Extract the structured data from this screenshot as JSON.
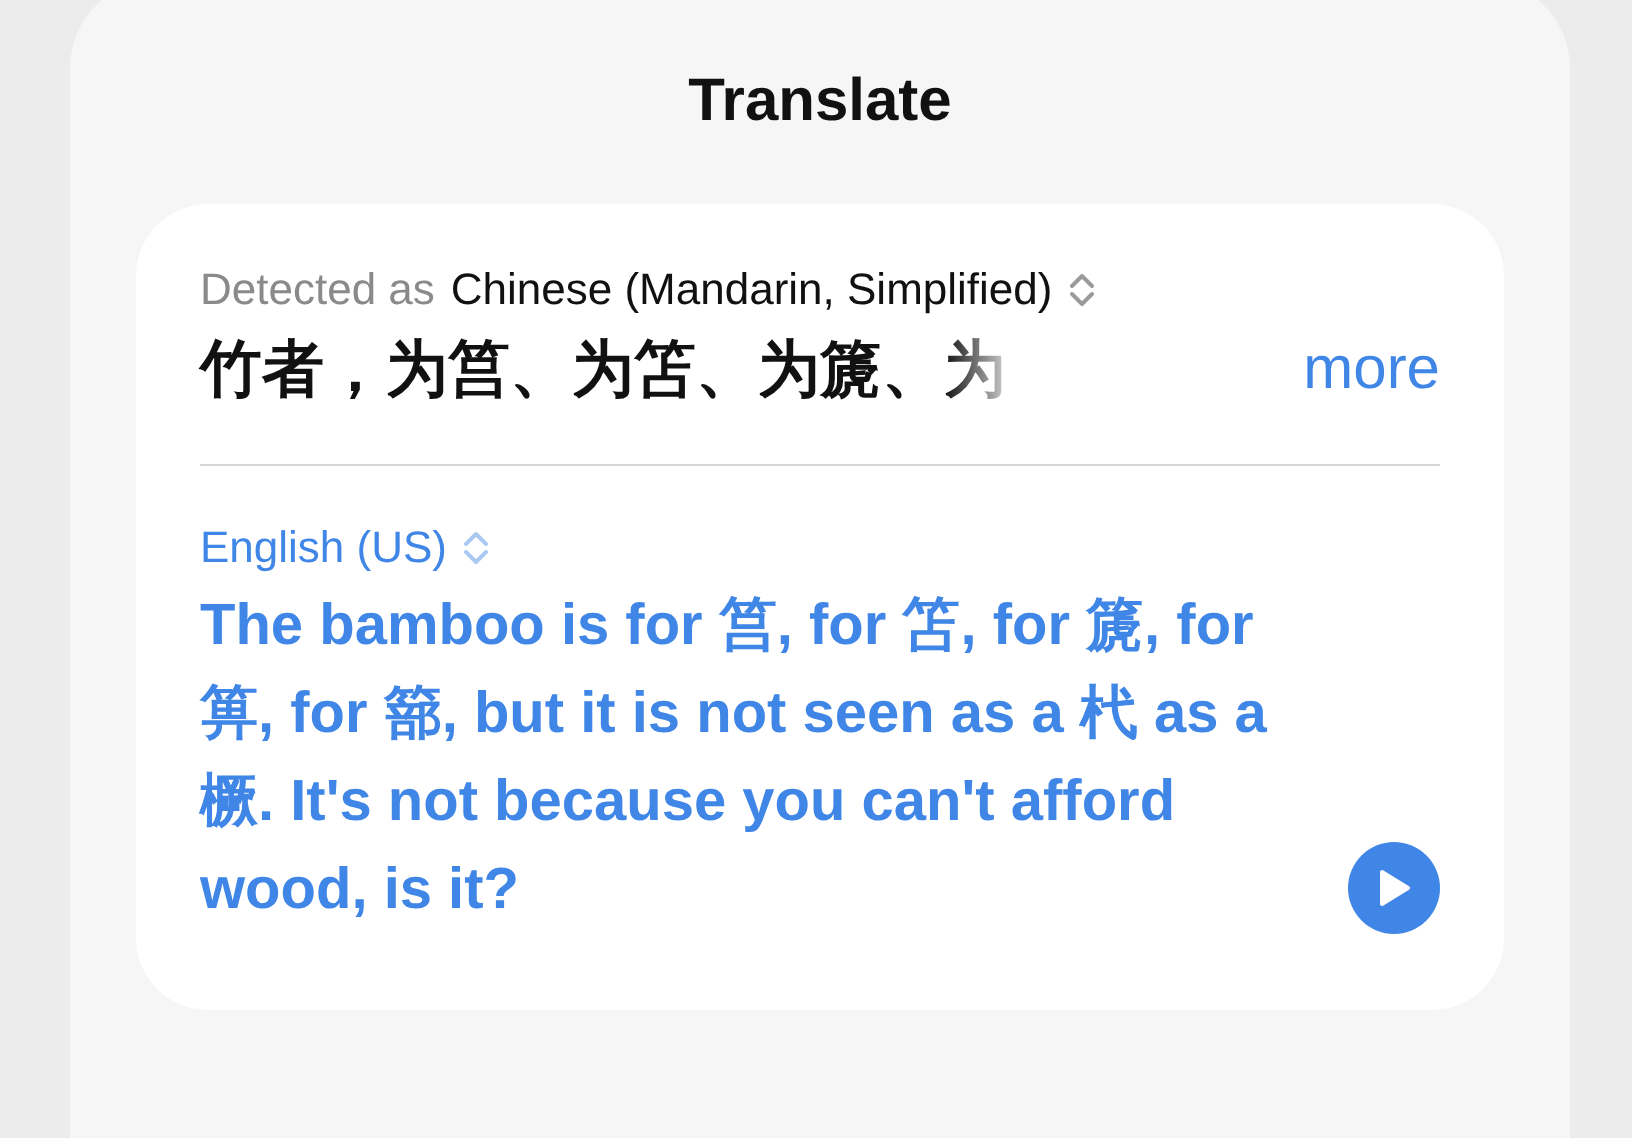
{
  "sheet": {
    "title": "Translate"
  },
  "source": {
    "prefix": "Detected as",
    "language": "Chinese (Mandarin, Simplified)",
    "text": "竹者，为筥、为笘、为篪、",
    "faded_text": "为",
    "more_link": "more"
  },
  "target": {
    "language": "English (US)",
    "text": "The bamboo is for 筥, for 笘, for 篪, for 箅, for 篰, but it is not seen as a 杙 as a 橛. It's not because you can't afford wood, is it?"
  }
}
